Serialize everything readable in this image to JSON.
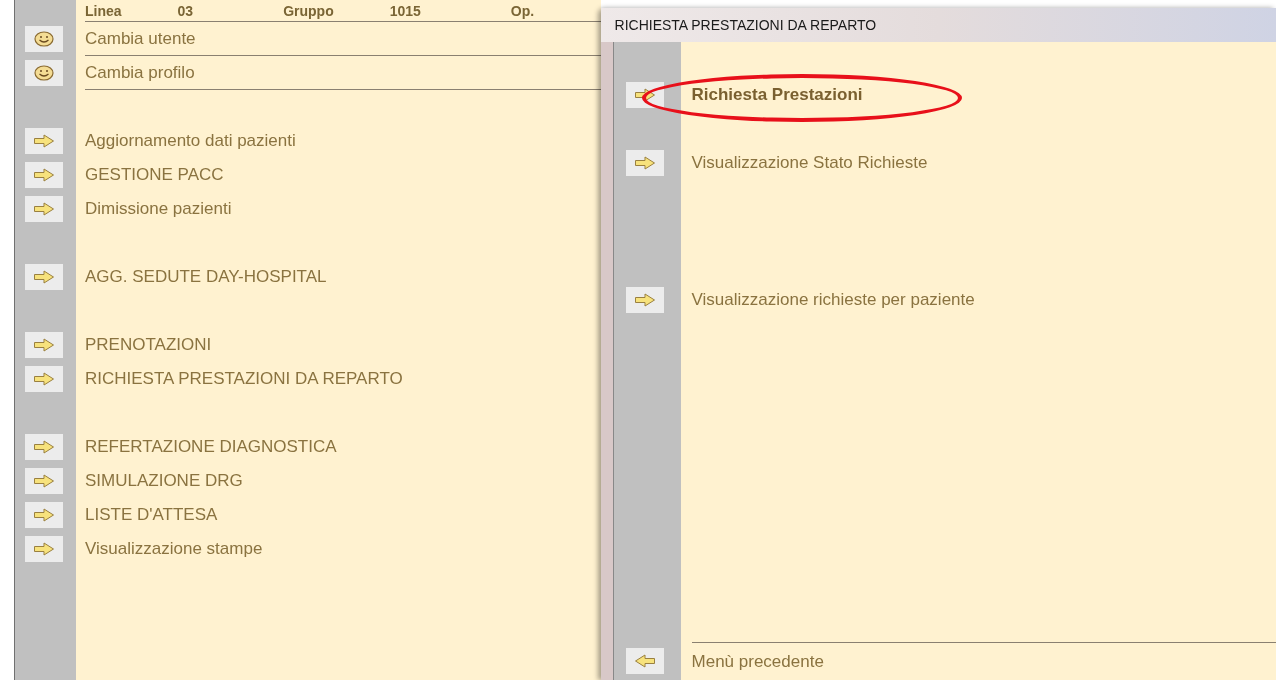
{
  "main_menu": {
    "header": [
      {
        "label": "Linea",
        "value": "03"
      },
      {
        "label": "Gruppo",
        "value": "1015"
      },
      {
        "label": "Op."
      }
    ],
    "account_items": [
      {
        "kind": "smiley",
        "label": "Cambia utente"
      },
      {
        "kind": "smiley",
        "label": "Cambia profilo"
      }
    ],
    "groups": [
      [
        {
          "kind": "arrow",
          "label": "Aggiornamento dati pazienti"
        },
        {
          "kind": "arrow",
          "label": "GESTIONE PACC"
        },
        {
          "kind": "arrow",
          "label": "Dimissione pazienti"
        }
      ],
      [
        {
          "kind": "arrow",
          "label": "AGG. SEDUTE DAY-HOSPITAL"
        }
      ],
      [
        {
          "kind": "arrow",
          "label": "PRENOTAZIONI"
        },
        {
          "kind": "arrow",
          "label": "RICHIESTA PRESTAZIONI DA REPARTO"
        }
      ],
      [
        {
          "kind": "arrow",
          "label": "REFERTAZIONE DIAGNOSTICA"
        },
        {
          "kind": "arrow",
          "label": "SIMULAZIONE DRG"
        },
        {
          "kind": "arrow",
          "label": "LISTE D'ATTESA"
        },
        {
          "kind": "arrow",
          "label": "Visualizzazione stampe"
        }
      ]
    ]
  },
  "dialog": {
    "title": "RICHIESTA PRESTAZIONI DA REPARTO",
    "items": [
      {
        "kind": "arrow",
        "label": "Richiesta Prestazioni",
        "bold": true,
        "circled": true
      },
      {
        "kind": "arrow",
        "label": "Visualizzazione Stato Richieste",
        "bold": false,
        "circled": false
      },
      {
        "kind": "arrow",
        "label": "Visualizzazione richieste per paziente",
        "bold": false,
        "circled": false
      }
    ],
    "footer": {
      "kind": "back",
      "label": "Menù precedente"
    }
  }
}
